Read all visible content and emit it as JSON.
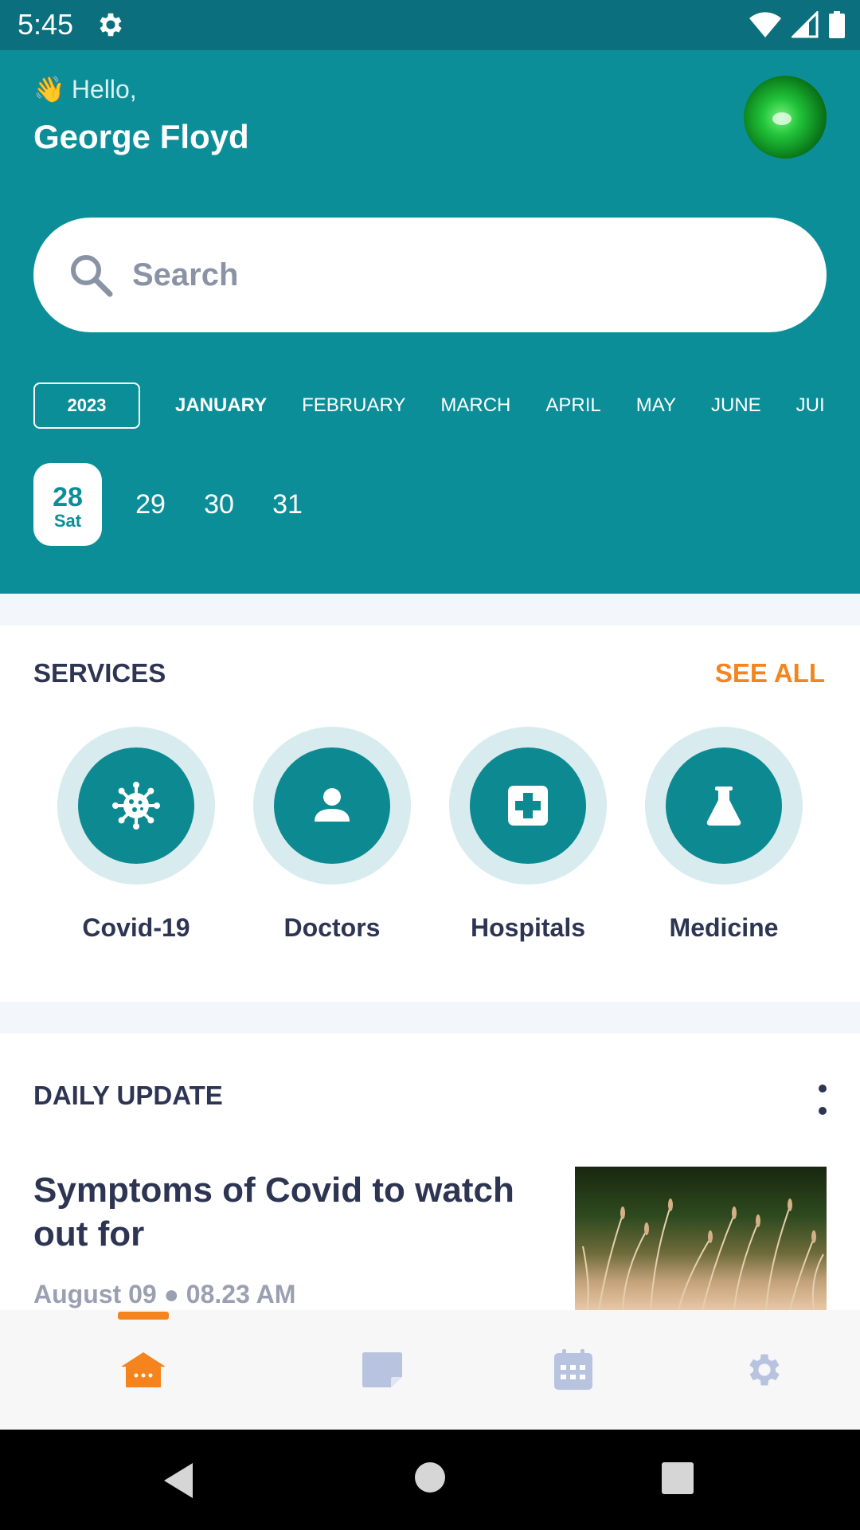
{
  "status_bar": {
    "time": "5:45"
  },
  "header": {
    "greeting_emoji": "👋",
    "greeting": "Hello,",
    "user_name": "George Floyd"
  },
  "search": {
    "placeholder": "Search"
  },
  "calendar": {
    "year": "2023",
    "months": [
      "JANUARY",
      "FEBRUARY",
      "MARCH",
      "APRIL",
      "MAY",
      "JUNE",
      "JUI"
    ],
    "selected_date": {
      "day_number": "28",
      "day_name": "Sat"
    },
    "dates": [
      "29",
      "30",
      "31"
    ]
  },
  "services": {
    "title": "SERVICES",
    "see_all": "SEE ALL",
    "items": [
      {
        "label": "Covid-19",
        "icon": "virus-icon"
      },
      {
        "label": "Doctors",
        "icon": "person-icon"
      },
      {
        "label": "Hospitals",
        "icon": "hospital-cross-icon"
      },
      {
        "label": "Medicine",
        "icon": "flask-icon"
      }
    ]
  },
  "daily_update": {
    "title": "DAILY UPDATE",
    "article": {
      "title": "Symptoms of Covid to watch out for",
      "meta": "August 09 ● 08.23 AM"
    }
  },
  "bottom_nav": {
    "items": [
      "home-icon",
      "news-icon",
      "calendar-icon",
      "settings-icon"
    ],
    "active": "home-icon"
  },
  "colors": {
    "header": "#0c8e99",
    "status_bar": "#0b6f7d",
    "accent": "#f5841f",
    "text_dark": "#2d3553",
    "service_fill": "#0d8a91",
    "service_ring": "#d8ecef"
  }
}
